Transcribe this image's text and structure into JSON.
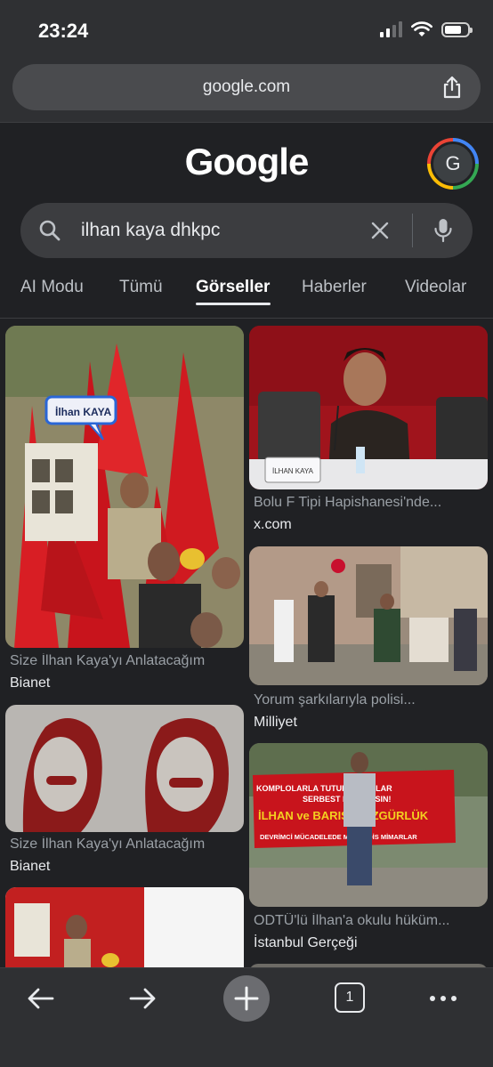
{
  "status": {
    "time": "23:24"
  },
  "browser": {
    "url": "google.com"
  },
  "google": {
    "logo": "Google",
    "avatar_letter": "G"
  },
  "search": {
    "query": "ilhan kaya dhkpc"
  },
  "tabs": [
    "AI Modu",
    "Tümü",
    "Görseller",
    "Haberler",
    "Videolar"
  ],
  "active_tab": "Görseller",
  "results": {
    "left": [
      {
        "caption": "Size İlhan Kaya'yı Anlatacağım",
        "source": "Bianet",
        "overlay": "İlhan KAYA"
      },
      {
        "caption": "Size İlhan Kaya'yı Anlatacağım",
        "source": "Bianet"
      }
    ],
    "right": [
      {
        "caption": "Bolu F Tipi Hapishanesi'nde...",
        "source": "x.com",
        "overlay": "İLHAN KAYA"
      },
      {
        "caption": "Yorum şarkılarıyla polisi...",
        "source": "Milliyet"
      },
      {
        "caption": "ODTÜ'lü İlhan'a okulu hüküm...",
        "source": "İstanbul Gerçeği",
        "banner": [
          "KOMPLOLARLA TUTUKLANANLAR",
          "SERBEST BIRAKILSIN!",
          "İLHAN ve BARIŞ'A ÖZGÜRLÜK",
          "DEVRİMCİ MÜCADELEDE MÜHENDİS MİMARLAR"
        ]
      }
    ]
  },
  "toolbar": {
    "tab_count": "1"
  },
  "colors": {
    "background": "#202124",
    "chrome": "#2f3033",
    "accent_red": "#c8102e"
  }
}
